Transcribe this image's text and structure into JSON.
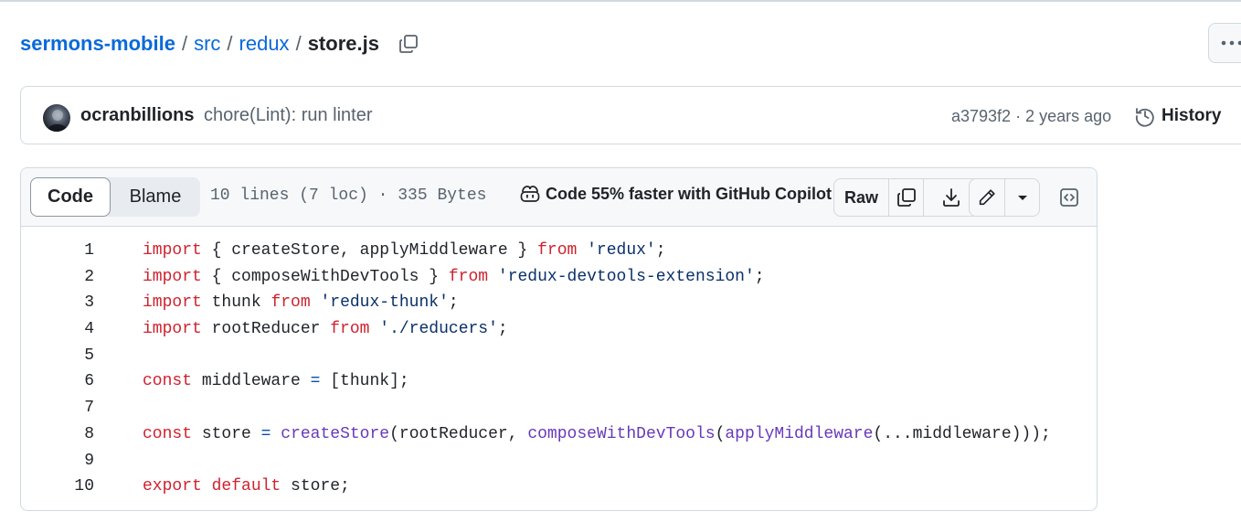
{
  "breadcrumb": {
    "repo": "sermons-mobile",
    "dir1": "src",
    "dir2": "redux",
    "file": "store.js",
    "separator": "/"
  },
  "commit": {
    "author": "ocranbillions",
    "message": "chore(Lint): run linter",
    "meta": "a3793f2 · 2 years ago",
    "history_label": "History"
  },
  "file_header": {
    "tab_code": "Code",
    "tab_blame": "Blame",
    "active_tab": "Code",
    "stats": "10 lines (7 loc) · 335 Bytes",
    "copilot_text": "Code 55% faster with GitHub Copilot",
    "raw_label": "Raw"
  },
  "code": {
    "lines": [
      [
        [
          "kw",
          "import"
        ],
        [
          "",
          "{ createStore, applyMiddleware } "
        ],
        [
          "kw",
          "from"
        ],
        [
          "",
          " "
        ],
        [
          "str",
          "'redux'"
        ],
        [
          "",
          ";"
        ]
      ],
      [
        [
          "kw",
          "import"
        ],
        [
          "",
          "{ composeWithDevTools } "
        ],
        [
          "kw",
          "from"
        ],
        [
          "",
          " "
        ],
        [
          "str",
          "'redux-devtools-extension'"
        ],
        [
          "",
          ";"
        ]
      ],
      [
        [
          "kw",
          "import"
        ],
        [
          "",
          " thunk "
        ],
        [
          "kw",
          "from"
        ],
        [
          "",
          " "
        ],
        [
          "str",
          "'redux-thunk'"
        ],
        [
          "",
          ";"
        ]
      ],
      [
        [
          "kw",
          "import"
        ],
        [
          "",
          " rootReducer "
        ],
        [
          "kw",
          "from"
        ],
        [
          "",
          " "
        ],
        [
          "str",
          "'./reducers'"
        ],
        [
          "",
          ";"
        ]
      ],
      [],
      [
        [
          "kw",
          "const"
        ],
        [
          "",
          " middleware "
        ],
        [
          "op",
          "="
        ],
        [
          "",
          " [thunk];"
        ]
      ],
      [],
      [
        [
          "kw",
          "const"
        ],
        [
          "",
          " store "
        ],
        [
          "op",
          "="
        ],
        [
          "",
          " "
        ],
        [
          "fn",
          "createStore"
        ],
        [
          "",
          "(rootReducer, "
        ],
        [
          "fn",
          "composeWithDevTools"
        ],
        [
          "",
          "("
        ],
        [
          "fn",
          "applyMiddleware"
        ],
        [
          "",
          "(...middleware)));"
        ]
      ],
      [],
      [
        [
          "kw",
          "export"
        ],
        [
          "",
          " "
        ],
        [
          "kw",
          "default"
        ],
        [
          "",
          " store;"
        ]
      ]
    ]
  },
  "colors": {
    "link": "#0969da",
    "keyword": "#cf222e",
    "string": "#0a3069",
    "function": "#6639ba",
    "operator": "#0550ae",
    "border": "#d1d9e0"
  },
  "icons": [
    "copy-icon",
    "kebab-icon",
    "history-icon",
    "copilot-icon",
    "download-icon",
    "pencil-icon",
    "chevron-down-icon",
    "code-square-icon"
  ]
}
